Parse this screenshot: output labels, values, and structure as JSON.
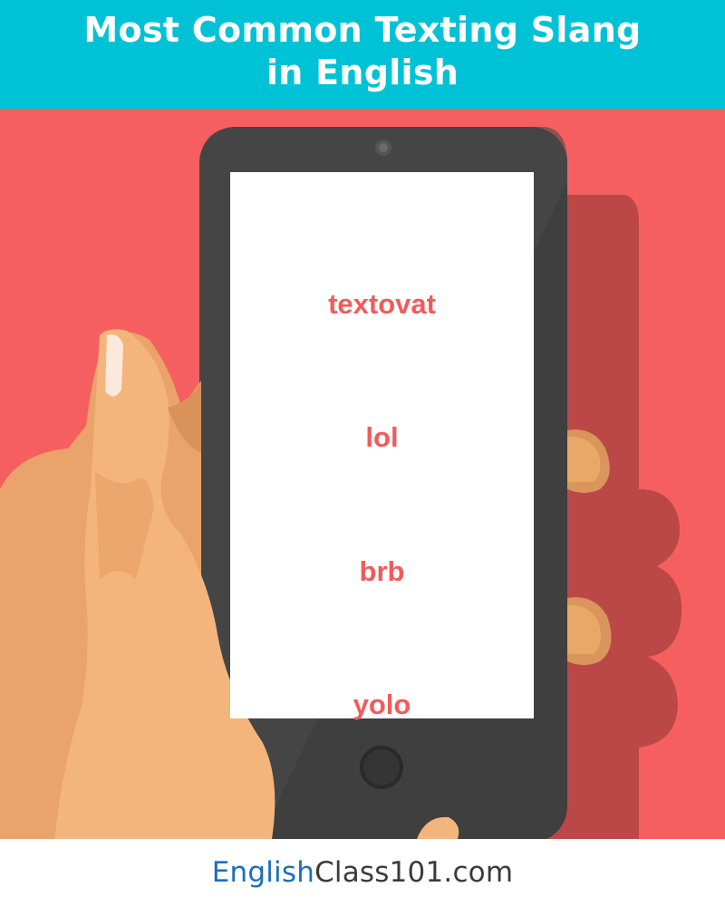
{
  "header": {
    "title_line1": "Most Common Texting Slang",
    "title_line2": "in English"
  },
  "phone": {
    "slang_words": [
      "textovat",
      "lol",
      "brb",
      "yolo"
    ]
  },
  "footer": {
    "brand_part1": "English",
    "brand_part2": "Class101.com"
  },
  "colors": {
    "header_bg": "#00c2d6",
    "scene_bg": "#f65f60",
    "slang_text": "#f15b5c",
    "brand_blue": "#1a6fc0",
    "phone_body": "#3f3f3f"
  },
  "icons": {
    "hand": "hand-illustration",
    "phone": "smartphone-illustration"
  }
}
